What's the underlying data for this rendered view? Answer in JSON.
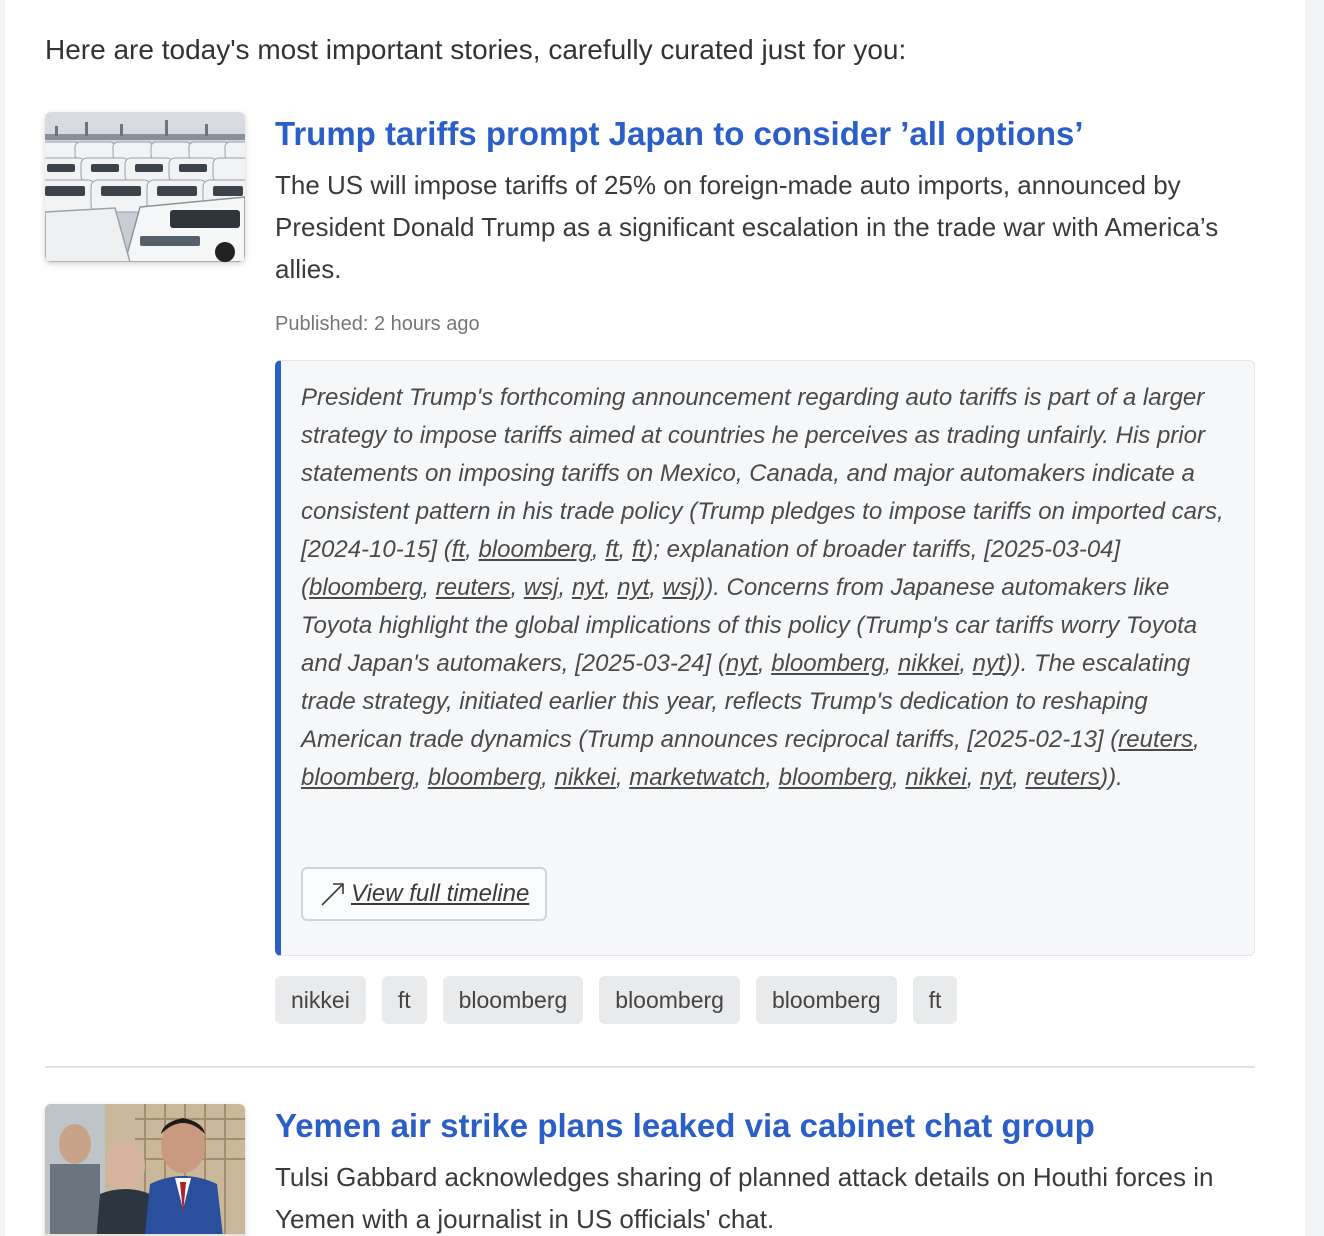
{
  "intro": "Here are today's most important stories, carefully curated just for you:",
  "stories": [
    {
      "title": "Trump tariffs prompt Japan to consider ’all options’",
      "summary": "The US will impose tariffs of 25% on foreign-made auto imports, announced by President Donald Trump as a significant escalation in the trade war with America’s allies.",
      "published_label": "Published:",
      "published_value": "2 hours ago",
      "context": {
        "t1": "President Trump's forthcoming announcement regarding auto tariffs is part of a larger strategy to impose tariffs aimed at countries he perceives as trading unfairly. His prior statements on imposing tariffs on Mexico, Canada, and major automakers indicate a consistent pattern in his trade policy (Trump pledges to impose tariffs on imported cars, [2024-10-15] (",
        "g1": [
          "ft",
          "bloomberg",
          "ft",
          "ft"
        ],
        "t2": "); explanation of broader tariffs, [2025-03-04] (",
        "g2": [
          "bloomberg",
          "reuters",
          "wsj",
          "nyt",
          "nyt",
          "wsj"
        ],
        "t3": ")). Concerns from Japanese automakers like Toyota highlight the global implications of this policy (Trump's car tariffs worry Toyota and Japan's automakers, [2025-03-24] (",
        "g3": [
          "nyt",
          "bloomberg",
          "nikkei",
          "nyt"
        ],
        "t4": ")). The escalating trade strategy, initiated earlier this year, reflects Trump's dedication to reshaping American trade dynamics (Trump announces reciprocal tariffs, [2025-02-13] (",
        "g4": [
          "reuters",
          "bloomberg",
          "bloomberg",
          "nikkei",
          "marketwatch",
          "bloomberg",
          "nikkei",
          "nyt",
          "reuters"
        ],
        "t5": "))."
      },
      "timeline_button": "View full timeline",
      "tags": [
        "nikkei",
        "ft",
        "bloomberg",
        "bloomberg",
        "bloomberg",
        "ft"
      ]
    },
    {
      "title": "Yemen air strike plans leaked via cabinet chat group",
      "summary": "Tulsi Gabbard acknowledges sharing of planned attack details on Houthi forces in Yemen with a journalist in US officials' chat."
    }
  ],
  "icons": {
    "timeline_button": "external-arrow-icon"
  },
  "colors": {
    "headline": "#2b5fc7",
    "accent_border": "#2b5fc7",
    "tag_bg": "#e9eaec",
    "context_bg": "#f6f7f9"
  }
}
